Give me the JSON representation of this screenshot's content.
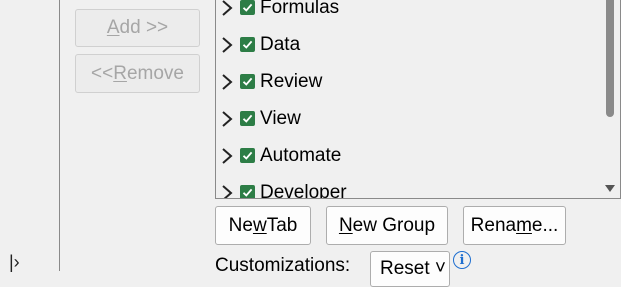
{
  "left_panel": {
    "caret": "|›"
  },
  "buttons": {
    "add": {
      "prefix": "",
      "accel": "A",
      "rest": "dd >>"
    },
    "remove": {
      "prefix": "<< ",
      "accel": "R",
      "rest": "emove"
    },
    "new_tab": {
      "prefix": "Ne",
      "accel": "w",
      "rest": " Tab"
    },
    "new_group": {
      "prefix": "",
      "accel": "N",
      "rest": "ew Group"
    },
    "rename": {
      "prefix": "Rena",
      "accel": "m",
      "rest": "e..."
    },
    "reset": "Reset ˅"
  },
  "tree": {
    "items": [
      {
        "label": "Formulas",
        "checked": true
      },
      {
        "label": "Data",
        "checked": true
      },
      {
        "label": "Review",
        "checked": true
      },
      {
        "label": "View",
        "checked": true
      },
      {
        "label": "Automate",
        "checked": true
      },
      {
        "label": "Developer",
        "checked": true
      }
    ]
  },
  "customizations": {
    "label": "Customizations:"
  },
  "info": {
    "glyph": "i"
  },
  "colors": {
    "check": "#2d7d46",
    "info": "#1f6fd0"
  }
}
